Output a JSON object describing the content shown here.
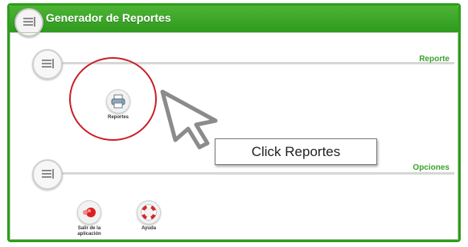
{
  "window": {
    "title": "Generador de Reportes"
  },
  "sections": [
    {
      "label": "Reporte"
    },
    {
      "label": "Opciones"
    }
  ],
  "reporte_buttons": [
    {
      "label": "Reportes",
      "icon": "printer-icon"
    }
  ],
  "opciones_buttons": [
    {
      "label_line1": "Salir de la",
      "label_line2": "aplicación",
      "icon": "exit-icon"
    },
    {
      "label": "Ayuda",
      "icon": "lifebuoy-icon"
    }
  ],
  "annotation": {
    "callout_text": "Click Reportes"
  },
  "colors": {
    "accent": "#2d9f1a",
    "highlight": "#c8202a"
  }
}
